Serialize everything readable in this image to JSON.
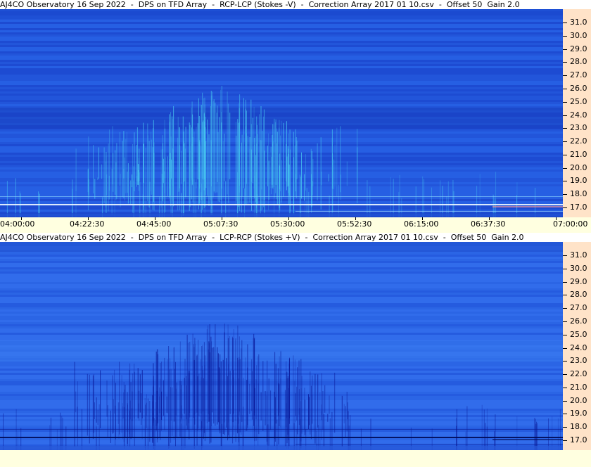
{
  "panels": [
    {
      "title": "AJ4CO Observatory 16 Sep 2022  -  DPS on TFD Array  -  RCP-LCP (Stokes -V)  -  Correction Array 2017 01 10.csv  -  Offset 50  Gain 2.0",
      "polarity": "positive",
      "colors": {
        "base": "#1e4fd6",
        "bright": "#47c8f0"
      }
    },
    {
      "title": "AJ4CO Observatory 16 Sep 2022  -  DPS on TFD Array  -  LCP-RCP (Stokes +V)  -  Correction Array 2017 01 10.csv  -  Offset 50  Gain 2.0",
      "polarity": "negative",
      "colors": {
        "base": "#2a62e6",
        "dark": "#0a1a9a"
      }
    }
  ],
  "frequency_axis_labels": [
    "31.0",
    "30.0",
    "29.0",
    "28.0",
    "27.0",
    "26.0",
    "25.0",
    "24.0",
    "23.0",
    "22.0",
    "21.0",
    "20.0",
    "19.0",
    "18.0",
    "17.0"
  ],
  "time_axis_labels": [
    "04:00:00",
    "04:22:30",
    "04:45:00",
    "05:07:30",
    "05:30:00",
    "05:52:30",
    "06:15:00",
    "06:37:30",
    "07:00:00"
  ],
  "colors": {
    "axis_bg": "#ffe3c8",
    "time_strip_bg": "#ffffe0"
  }
}
